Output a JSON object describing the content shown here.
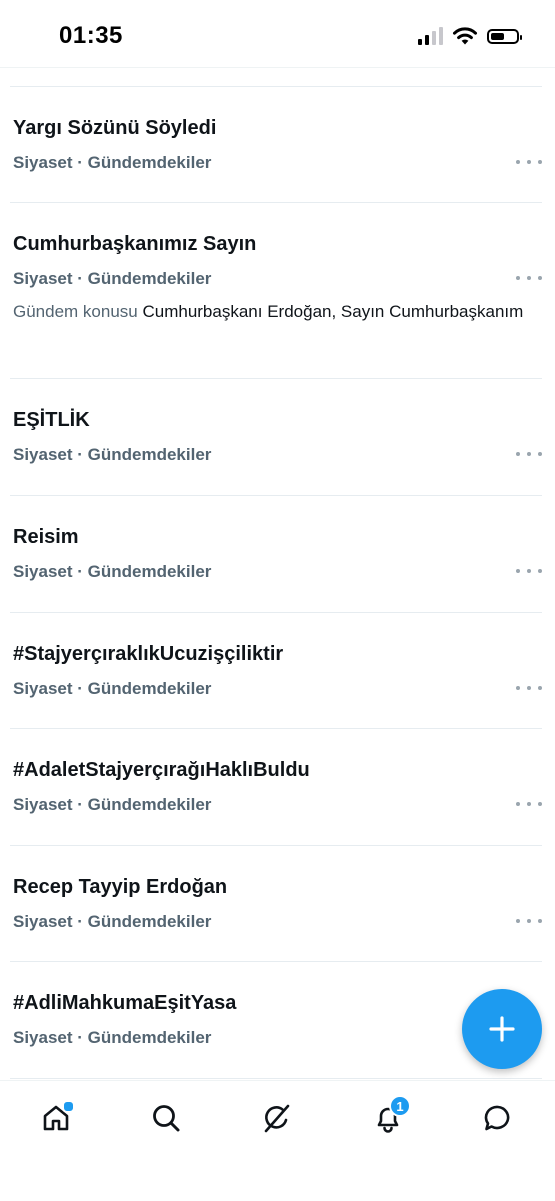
{
  "status_bar": {
    "time": "01:35"
  },
  "trends": [
    {
      "title": "Yargı Sözünü Söyledi",
      "meta": "Siyaset · Gündemdekiler"
    },
    {
      "title": "Cumhurbaşkanımız Sayın",
      "meta": "Siyaset · Gündemdekiler",
      "extra_prefix": "Gündem konusu",
      "extra_text": " Cumhurbaşkanı Erdoğan, Sayın Cumhurbaşkanım"
    },
    {
      "title": "EŞİTLİK",
      "meta": "Siyaset · Gündemdekiler"
    },
    {
      "title": "Reisim",
      "meta": "Siyaset · Gündemdekiler"
    },
    {
      "title": "#StajyerçıraklıkUcuzişçiliktir",
      "meta": "Siyaset · Gündemdekiler"
    },
    {
      "title": "#AdaletStajyerçırağıHaklıBuldu",
      "meta": "Siyaset · Gündemdekiler"
    },
    {
      "title": "Recep Tayyip Erdoğan",
      "meta": "Siyaset · Gündemdekiler"
    },
    {
      "title": "#AdliMahkumaEşitYasa",
      "meta": "Siyaset · Gündemdekiler"
    }
  ],
  "bottom_nav": {
    "items": [
      "home-icon",
      "search-icon",
      "grok-icon",
      "bell-icon",
      "messages-icon"
    ],
    "notification_count": "1"
  },
  "colors": {
    "accent": "#1d9bf0",
    "secondary_text": "#536471",
    "separator": "#e6ecf0"
  }
}
